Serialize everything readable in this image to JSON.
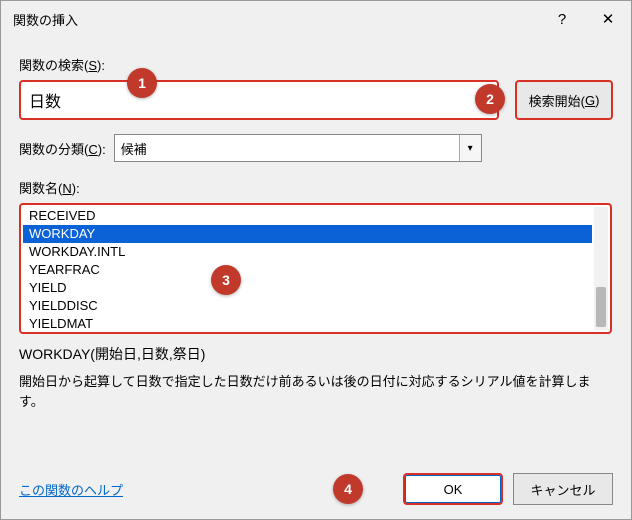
{
  "titlebar": {
    "title": "関数の挿入",
    "help": "?",
    "close": "✕"
  },
  "search": {
    "label_pre": "関数の検索(",
    "label_key": "S",
    "label_post": "):",
    "value": "日数",
    "button_pre": "検索開始(",
    "button_key": "G",
    "button_post": ")"
  },
  "category": {
    "label_pre": "関数の分類(",
    "label_key": "C",
    "label_post": "):",
    "value": "候補"
  },
  "funclist": {
    "label_pre": "関数名(",
    "label_key": "N",
    "label_post": "):",
    "items": [
      "RECEIVED",
      "WORKDAY",
      "WORKDAY.INTL",
      "YEARFRAC",
      "YIELD",
      "YIELDDISC",
      "YIELDMAT"
    ],
    "selected_index": 1
  },
  "details": {
    "syntax": "WORKDAY(開始日,日数,祭日)",
    "description": "開始日から起算して日数で指定した日数だけ前あるいは後の日付に対応するシリアル値を計算します。"
  },
  "footer": {
    "help_link": "この関数のヘルプ",
    "ok": "OK",
    "cancel": "キャンセル"
  },
  "badges": [
    "1",
    "2",
    "3",
    "4"
  ]
}
